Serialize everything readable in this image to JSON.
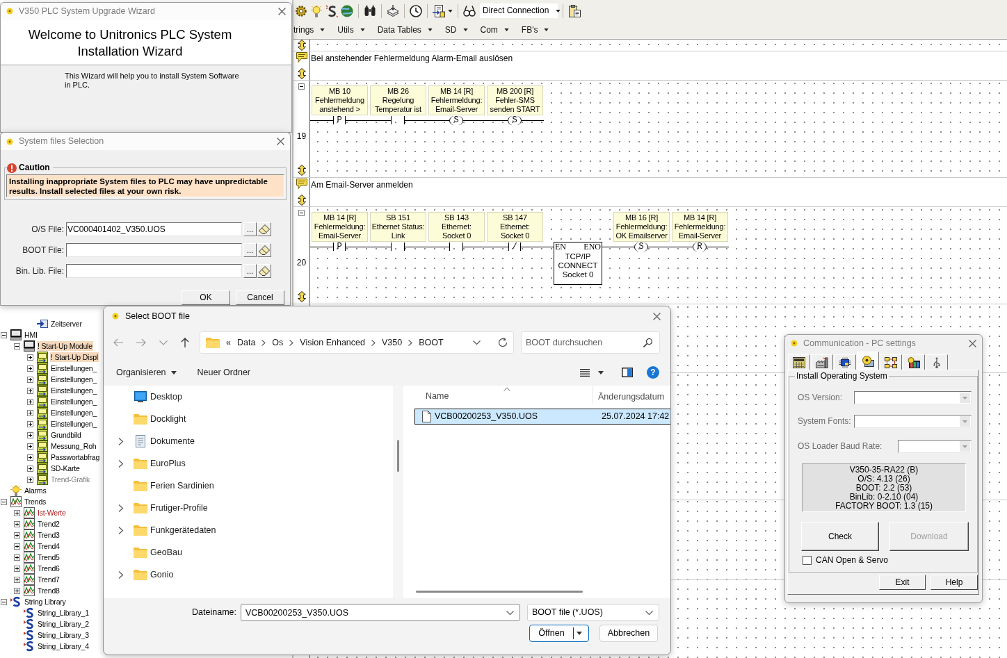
{
  "toolbar": {
    "connection": "Direct Connection",
    "menus": [
      "trings",
      "Utils",
      "Data Tables",
      "SD",
      "Com",
      "FB's"
    ]
  },
  "ladder": {
    "rungs": [
      {
        "number": "19",
        "comment": "Bei anstehender Fehlermeldung Alarm-Email auslösen",
        "elements": [
          {
            "kind": "contact",
            "symbol": "P",
            "lines": [
              "MB 10",
              "Fehlermeldung",
              "anstehend >"
            ]
          },
          {
            "kind": "contact",
            "lines": [
              "MB 26",
              "Regelung",
              "Temperatur ist"
            ]
          },
          {
            "kind": "coil",
            "symbol": "S",
            "lines": [
              "MB 14 [R]",
              "Fehlermeldung:",
              "Email-Server"
            ]
          },
          {
            "kind": "coil",
            "symbol": "S",
            "lines": [
              "MB 200 [R]",
              "Fehler-SMS",
              "senden START"
            ]
          }
        ]
      },
      {
        "number": "20",
        "comment": "Am Email-Server anmelden",
        "elements": [
          {
            "kind": "contact",
            "symbol": "P",
            "lines": [
              "MB 14 [R]",
              "Fehlermeldung:",
              "Email-Server"
            ]
          },
          {
            "kind": "contact",
            "lines": [
              "SB 151",
              "Ethernet Status:",
              "Link"
            ]
          },
          {
            "kind": "contact",
            "lines": [
              "SB 143",
              "Ethernet:",
              "Socket 0"
            ]
          },
          {
            "kind": "contact",
            "symbol": "/",
            "lines": [
              "SB 147",
              "Ethernet:",
              "Socket 0"
            ]
          },
          {
            "kind": "function",
            "pins": [
              "EN",
              "ENO"
            ],
            "lines": [
              "TCP/IP",
              "CONNECT",
              "Socket 0"
            ]
          },
          {
            "kind": "coil",
            "symbol": "S",
            "lines": [
              "MB 16 [R]",
              "Fehlermeldung:",
              "OK Emailserver"
            ]
          },
          {
            "kind": "coil",
            "symbol": "R",
            "lines": [
              "MB 14 [R]",
              "Fehlermeldung:",
              "Email-Server"
            ]
          }
        ]
      }
    ]
  },
  "tree": {
    "cut_off_items": [
      {
        "label": "Zeitserver",
        "kind": "link",
        "selected": false
      }
    ],
    "items": [
      {
        "label": "HMI",
        "kind": "hmi",
        "expanded": true,
        "selected": false,
        "children": [
          {
            "label": "! Start-Up Module",
            "kind": "hmi",
            "expanded": true,
            "selected": true,
            "children": [
              {
                "label": "! Start-Up Displ",
                "kind": "display",
                "expanded": false,
                "selected": true
              },
              {
                "label": "Einstellungen_",
                "kind": "display",
                "expanded": false,
                "selected": false
              },
              {
                "label": "Einstellungen_",
                "kind": "display",
                "expanded": false,
                "selected": false
              },
              {
                "label": "Einstellungen_",
                "kind": "display",
                "expanded": false,
                "selected": false
              },
              {
                "label": "Einstellungen_",
                "kind": "display",
                "expanded": false,
                "selected": false
              },
              {
                "label": "Einstellungen_",
                "kind": "display",
                "expanded": false,
                "selected": false
              },
              {
                "label": "Einstellungen_",
                "kind": "display",
                "expanded": false,
                "selected": false
              },
              {
                "label": "Grundbild",
                "kind": "display",
                "expanded": false,
                "selected": false
              },
              {
                "label": "Messung_Roh",
                "kind": "display",
                "expanded": false,
                "selected": false
              },
              {
                "label": "Passwortabfrag",
                "kind": "display",
                "expanded": false,
                "selected": false
              },
              {
                "label": "SD-Karte",
                "kind": "display",
                "expanded": false,
                "selected": false
              },
              {
                "label": "Trend-Grafik",
                "kind": "display",
                "expanded": false,
                "selected": false,
                "color": "#808080"
              }
            ]
          }
        ]
      },
      {
        "label": "Alarms",
        "kind": "alarm",
        "selected": false
      },
      {
        "label": "Trends",
        "kind": "trend",
        "expanded": true,
        "selected": false,
        "children": [
          {
            "label": "Ist-Werte",
            "kind": "trend",
            "expanded": false,
            "selected": false,
            "color": "#b22222"
          },
          {
            "label": "Trend2",
            "kind": "trend",
            "expanded": false,
            "selected": false
          },
          {
            "label": "Trend3",
            "kind": "trend",
            "expanded": false,
            "selected": false
          },
          {
            "label": "Trend4",
            "kind": "trend",
            "expanded": false,
            "selected": false
          },
          {
            "label": "Trend5",
            "kind": "trend",
            "expanded": false,
            "selected": false
          },
          {
            "label": "Trend6",
            "kind": "trend",
            "expanded": false,
            "selected": false
          },
          {
            "label": "Trend7",
            "kind": "trend",
            "expanded": false,
            "selected": false
          },
          {
            "label": "Trend8",
            "kind": "trend",
            "expanded": false,
            "selected": false
          }
        ]
      },
      {
        "label": "String Library",
        "kind": "library",
        "expanded": true,
        "selected": false,
        "children": [
          {
            "label": "String_Library_1",
            "kind": "library",
            "selected": false
          },
          {
            "label": "String_Library_2",
            "kind": "library",
            "selected": false
          },
          {
            "label": "String_Library_3",
            "kind": "library",
            "selected": false
          },
          {
            "label": "String_Library_4",
            "kind": "library",
            "selected": false
          }
        ]
      }
    ]
  },
  "wizard": {
    "title": "V350 PLC System Upgrade Wizard",
    "active": false,
    "heading": "Welcome to Unitronics PLC System Installation Wizard",
    "intro": "This Wizard will help you to install System Software in PLC."
  },
  "files_window": {
    "title": "System files Selection",
    "active": false,
    "caution_title": "Caution",
    "caution_text": "Installing inappropriate System files to PLC may have unpredictable results. Install selected files at your own risk.",
    "fields": [
      {
        "label": "O/S File:",
        "value": "VC000401402_V350.UOS",
        "browse": "..."
      },
      {
        "label": "BOOT File:",
        "browse": "..."
      },
      {
        "label": "Bin. Lib. File:",
        "browse": "..."
      }
    ],
    "buttons": [
      "OK",
      "Cancel"
    ]
  },
  "boot_dialog": {
    "title": "Select BOOT file",
    "active": true,
    "path_overflow": "«",
    "path": [
      "Data",
      "Os",
      "Vision Enhanced",
      "V350",
      "BOOT"
    ],
    "search_placeholder": "BOOT durchsuchen",
    "commands": [
      {
        "label": "Organisieren",
        "menu": true
      },
      {
        "label": "Neuer Ordner",
        "menu": false
      }
    ],
    "help": "?",
    "places": [
      {
        "label": "Desktop",
        "kind": "desktop",
        "expandable": false,
        "selected": false
      },
      {
        "label": "Docklight",
        "kind": "folder",
        "expandable": false,
        "selected": false
      },
      {
        "label": "Dokumente",
        "kind": "documents",
        "expandable": true,
        "selected": false
      },
      {
        "label": "EuroPlus",
        "kind": "folder",
        "expandable": true,
        "selected": false
      },
      {
        "label": "Ferien Sardinien",
        "kind": "folder",
        "expandable": false,
        "selected": false
      },
      {
        "label": "Frutiger-Profile",
        "kind": "folder",
        "expandable": true,
        "selected": false
      },
      {
        "label": "Funkgerätedaten",
        "kind": "folder",
        "expandable": true,
        "selected": false
      },
      {
        "label": "GeoBau",
        "kind": "folder",
        "expandable": false,
        "selected": false
      },
      {
        "label": "Gonio",
        "kind": "folder",
        "expandable": true,
        "selected": false
      }
    ],
    "columns": [
      "Name",
      "Änderungsdatum"
    ],
    "files": [
      {
        "name": "VCB00200253_V350.UOS",
        "date": "25.07.2024 17:42",
        "selected": true
      }
    ],
    "filename_label": "Dateiname:",
    "filename": "VCB00200253_V350.UOS",
    "file_type": "BOOT file (*.UOS)",
    "buttons": [
      {
        "label": "Öffnen",
        "kind": "split"
      },
      {
        "label": "Abbrechen",
        "kind": "plain"
      }
    ]
  },
  "comm_dialog": {
    "title": "Communication - PC settings",
    "active": false,
    "tabs": [
      {
        "kind": "keypad",
        "selected": false
      },
      {
        "kind": "factory",
        "selected": false
      },
      {
        "kind": "chip",
        "selected": false
      },
      {
        "kind": "disc",
        "selected": true
      },
      {
        "kind": "network",
        "selected": false
      },
      {
        "kind": "bars",
        "selected": false
      },
      {
        "kind": "usb",
        "selected": false
      }
    ],
    "group": "Install Operating System",
    "fields": [
      {
        "label": "OS Version:",
        "disabled": true
      },
      {
        "label": "System Fonts:",
        "disabled": true
      },
      {
        "label": "OS Loader Baud Rate:",
        "disabled": true
      }
    ],
    "info_lines": [
      "V350-35-RA22 (B)",
      "O/S: 4.13 (26)",
      "BOOT: 2.2 (53)",
      "BinLib: 0-2.10 (04)",
      "FACTORY BOOT: 1.3 (15)"
    ],
    "actions": [
      {
        "label": "Check",
        "disabled": false
      },
      {
        "label": "Download",
        "disabled": true
      }
    ],
    "option": {
      "label": "CAN Open & Servo",
      "checked": false
    },
    "buttons": [
      "Exit",
      "Help"
    ]
  }
}
